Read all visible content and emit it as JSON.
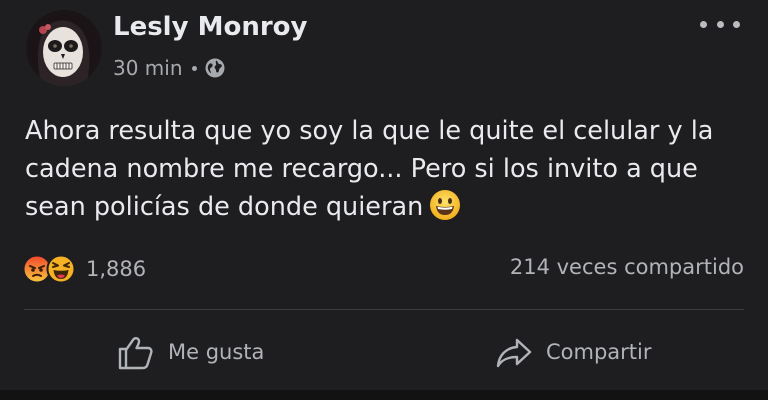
{
  "post": {
    "author_name": "Lesly Monroy",
    "time_ago": "30 min",
    "audience_icon": "globe-icon",
    "more_icon": "ellipsis-icon",
    "text_lines": [
      "Ahora resulta que yo soy la que le quite el celular y la",
      "cadena nombre me recargo... Pero si los invito a que",
      "sean policías de donde quieran"
    ],
    "trailing_emoji": "grinning-face-emoji"
  },
  "engagement": {
    "reaction_icons": [
      "angry-reaction-icon",
      "haha-reaction-icon"
    ],
    "reaction_count": "1,886",
    "shares": "214 veces compartido"
  },
  "actions": {
    "like_label": "Me gusta",
    "like_icon": "thumbs-up-icon",
    "share_label": "Compartir",
    "share_icon": "share-arrow-icon"
  },
  "colors": {
    "background": "#1e1e20",
    "text_primary": "#e9eaee",
    "text_secondary": "#b0b3b8",
    "angry_reaction": "#e9710f",
    "haha_reaction": "#f7b125"
  }
}
